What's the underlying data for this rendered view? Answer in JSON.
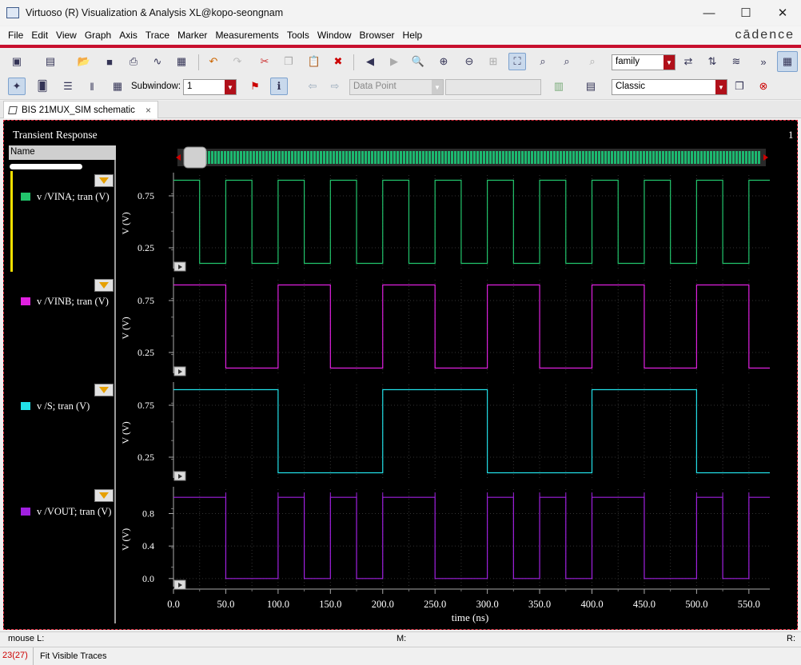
{
  "window": {
    "title": "Virtuoso (R) Visualization & Analysis XL@kopo-seongnam",
    "minimize": "—",
    "maximize": "☐",
    "close": "✕"
  },
  "menu": [
    "File",
    "Edit",
    "View",
    "Graph",
    "Axis",
    "Trace",
    "Marker",
    "Measurements",
    "Tools",
    "Window",
    "Browser",
    "Help"
  ],
  "brand": "cādence",
  "toolbar1": {
    "family_combo": "family"
  },
  "toolbar2": {
    "subwindow_label": "Subwindow:",
    "subwindow_value": "1",
    "data_point_combo": "Data Point",
    "style_combo": "Classic"
  },
  "tab": {
    "label": "BIS 21MUX_SIM schematic",
    "close": "×"
  },
  "plot": {
    "title": "Transient Response",
    "subwindow_number": "1",
    "name_header": "Name",
    "xlabel": "time (ns)"
  },
  "colors": {
    "vina": "#22c56c",
    "vinb": "#e020e0",
    "s": "#22e0e8",
    "vout": "#a020e0",
    "accent": "#c8102e"
  },
  "chart_data": [
    {
      "type": "line",
      "series": [
        {
          "name": "v /VINA; tran (V)",
          "color": "#22c56c"
        }
      ],
      "x_unit": "ns",
      "xlim": [
        0,
        570
      ],
      "ylim": [
        0.05,
        0.95
      ],
      "ylabel": "V (V)",
      "yticks": [
        "0.75",
        "0.25"
      ],
      "levels": {
        "high": 0.9,
        "low": 0.1
      },
      "period_ns": 50,
      "high_intervals_ns": [
        [
          0,
          25
        ],
        [
          50,
          75
        ],
        [
          100,
          125
        ],
        [
          150,
          175
        ],
        [
          200,
          225
        ],
        [
          250,
          275
        ],
        [
          300,
          325
        ],
        [
          350,
          375
        ],
        [
          400,
          425
        ],
        [
          450,
          475
        ],
        [
          500,
          525
        ],
        [
          550,
          570
        ]
      ]
    },
    {
      "type": "line",
      "series": [
        {
          "name": "v /VINB; tran (V)",
          "color": "#e020e0"
        }
      ],
      "x_unit": "ns",
      "xlim": [
        0,
        570
      ],
      "ylim": [
        0.05,
        0.95
      ],
      "ylabel": "V (V)",
      "yticks": [
        "0.75",
        "0.25"
      ],
      "levels": {
        "high": 0.9,
        "low": 0.1
      },
      "period_ns": 100,
      "high_intervals_ns": [
        [
          0,
          50
        ],
        [
          100,
          150
        ],
        [
          200,
          250
        ],
        [
          300,
          350
        ],
        [
          400,
          450
        ],
        [
          500,
          550
        ]
      ]
    },
    {
      "type": "line",
      "series": [
        {
          "name": "v /S; tran (V)",
          "color": "#22e0e8"
        }
      ],
      "x_unit": "ns",
      "xlim": [
        0,
        570
      ],
      "ylim": [
        0.05,
        0.95
      ],
      "ylabel": "V (V)",
      "yticks": [
        "0.75",
        "0.25"
      ],
      "levels": {
        "high": 0.9,
        "low": 0.1
      },
      "period_ns": 200,
      "high_intervals_ns": [
        [
          0,
          100
        ],
        [
          200,
          300
        ],
        [
          400,
          500
        ]
      ]
    },
    {
      "type": "line",
      "series": [
        {
          "name": "v /VOUT; tran (V)",
          "color": "#a020e0"
        }
      ],
      "x_unit": "ns",
      "xlim": [
        0,
        570
      ],
      "ylim": [
        -0.1,
        1.1
      ],
      "ylabel": "V (V)",
      "yticks": [
        "0.8",
        "0.4",
        "0.0"
      ],
      "levels": {
        "high": 1.0,
        "low": 0.0
      },
      "high_intervals_ns": [
        [
          0,
          50
        ],
        [
          100,
          125
        ],
        [
          150,
          175
        ],
        [
          200,
          250
        ],
        [
          300,
          325
        ],
        [
          350,
          375
        ],
        [
          400,
          450
        ],
        [
          500,
          525
        ],
        [
          550,
          570
        ]
      ],
      "glitch_times_ns": [
        50,
        100,
        125,
        150,
        175,
        200,
        250,
        300,
        325,
        350,
        375,
        400,
        450,
        500,
        525,
        550
      ]
    }
  ],
  "xaxis": {
    "ticks": [
      "0.0",
      "50.0",
      "100.0",
      "150.0",
      "200.0",
      "250.0",
      "300.0",
      "350.0",
      "400.0",
      "450.0",
      "500.0",
      "550.0"
    ],
    "tick_values": [
      0,
      50,
      100,
      150,
      200,
      250,
      300,
      350,
      400,
      450,
      500,
      550
    ]
  },
  "status": {
    "mouse": "mouse L:",
    "middle": "M:",
    "right": "R:",
    "counter": "23(27)",
    "message": "Fit Visible Traces"
  }
}
